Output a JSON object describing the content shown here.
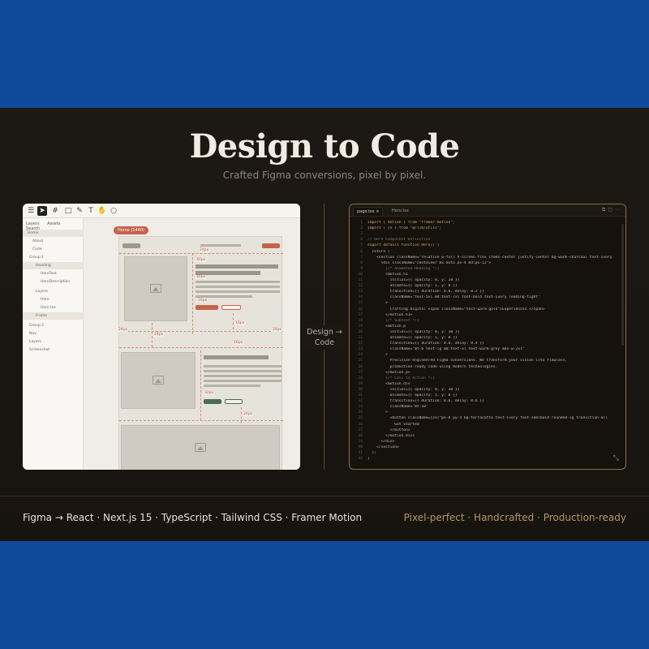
{
  "hero": {
    "title": "Design to Code",
    "subtitle": "Crafted Figma conversions, pixel by pixel.",
    "middle_label_1": "Design →",
    "middle_label_2": "Code"
  },
  "footer": {
    "stack": "Figma → React · Next.js 15 · TypeScript · Tailwind CSS · Framer Motion",
    "qualities": "Pixel-perfect · Handcrafted · Production-ready"
  },
  "figma": {
    "tabs": [
      "Layers",
      "Assets",
      "Search"
    ],
    "layers": [
      "Home",
      "About",
      "Code",
      "Group 1",
      "Heading",
      "HeroText",
      "HeroDescription",
      "Layers",
      "Hero",
      "Hero.tsx",
      "Frame",
      "Group 2",
      "Nav",
      "Layers",
      "Screenshot"
    ],
    "frame_badge": "Home (1440)",
    "measurements": [
      "24px",
      "40px",
      "40px",
      "16px",
      "24px",
      "16px",
      "24px",
      "24px",
      "16px",
      "32px",
      "24px"
    ]
  },
  "code": {
    "tabs": [
      "page.tsx",
      "Hero.tsx"
    ],
    "lines": [
      "import { motion } from \"framer-motion\";",
      "import { cn } from \"@/lib/utils\";",
      "",
      "// Hero Component Definition",
      "export default function Hero() {",
      "  return (",
      "    <section className=\"relative w-full h-screen flex items-center justify-center bg-warm-charcoal text-ivory",
      "      <div className=\"container mx-auto px-4 md:px-12\">",
      "        {/* Animated Heading */}",
      "        <motion.h1",
      "          initial={{ opacity: 0, y: 20 }}",
      "          animate={{ opacity: 1, y: 0 }}",
      "          transition={{ duration: 0.6, delay: 0.2 }}",
      "          className=\"text-5xl md:text-7xl font-bold text-ivory leading-tight\"",
      "        >",
      "          Crafting Digital <span className=\"text-warm-gold\">Experiences.</span>",
      "        </motion.h1>",
      "        {/* Subtext */}",
      "        <motion.p",
      "          initial={{ opacity: 0, y: 30 }}",
      "          animate={{ opacity: 1, y: 0 }}",
      "          transition={{ duration: 0.6, delay: 0.4 }}",
      "          className=\"mt-6 text-lg md:text-xl text-warm-grey max-w-2xl\"",
      "        >",
      "          Precision-engineered Figma conversions. We transform your vision into flawless,",
      "          production-ready code using modern technologies.",
      "        </motion.p>",
      "        {/* Call to Action */}",
      "        <motion.div",
      "          initial={{ opacity: 0, y: 30 }}",
      "          animate={{ opacity: 1, y: 0 }}",
      "          transition={{ duration: 0.6, delay: 0.6 }}",
      "          className=\"mt-10\"",
      "        >",
      "          <button className={cn(\"px-8 py-4 bg-terracotta text-ivory font-semibold rounded-lg transition-all",
      "            Get Started",
      "          </button>",
      "        </motion.div>",
      "      </div>",
      "    </section>",
      "  );",
      "}"
    ],
    "line_numbers": [
      "1",
      "2",
      "3",
      "4",
      "5",
      "6",
      "7",
      "8",
      "9",
      "10",
      "11",
      "12",
      "13",
      "14",
      "15",
      "16",
      "17",
      "18",
      "19",
      "20",
      "21",
      "22",
      "23",
      "24",
      "25",
      "26",
      "27",
      "28",
      "29",
      "30",
      "31",
      "32",
      "33",
      "34",
      "35",
      "36",
      "37",
      "38",
      "39",
      "40",
      "41",
      "42"
    ]
  },
  "colors": {
    "accent_terracotta": "#c5634a",
    "accent_gold": "#b59867",
    "background": "#1b1712",
    "banner": "#0f4a9a"
  }
}
